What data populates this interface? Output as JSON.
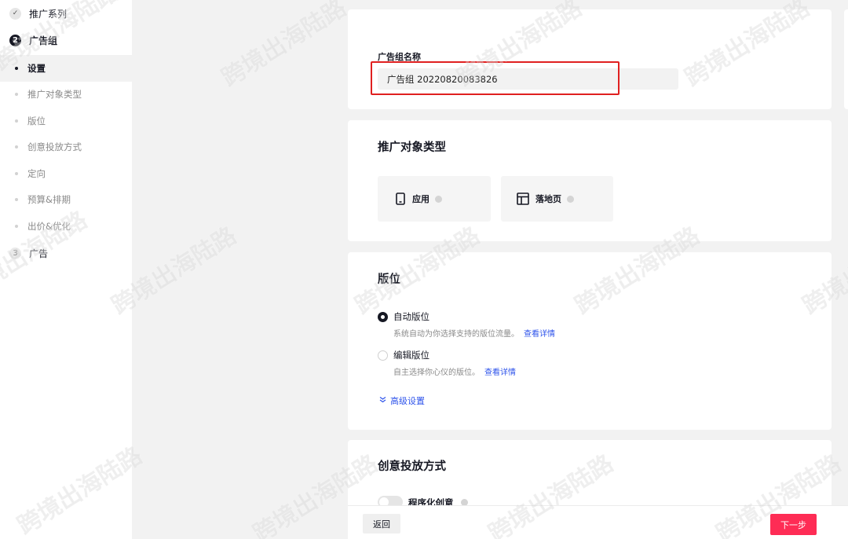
{
  "sidebar": {
    "steps": [
      {
        "index": "✓",
        "label": "推广系列"
      },
      {
        "index": "2",
        "label": "广告组"
      },
      {
        "index": "3",
        "label": "广告"
      }
    ],
    "subitems": [
      "设置",
      "推广对象类型",
      "版位",
      "创意投放方式",
      "定向",
      "预算&排期",
      "出价&优化"
    ]
  },
  "adgroup": {
    "name_label": "广告组名称",
    "name_value": "广告组 20220820083826"
  },
  "promo_type": {
    "title": "推广对象类型",
    "options": [
      "应用",
      "落地页"
    ]
  },
  "placement": {
    "title": "版位",
    "auto": {
      "label": "自动版位",
      "desc": "系统自动为你选择支持的版位流量。",
      "link": "查看详情"
    },
    "edit": {
      "label": "编辑版位",
      "desc": "自主选择你心仪的版位。",
      "link": "查看详情"
    },
    "advanced": "高级设置"
  },
  "creative": {
    "title": "创意投放方式",
    "toggle_label": "程序化创意"
  },
  "footer": {
    "back": "返回",
    "next": "下一步"
  },
  "watermark": "跨境出海陆路",
  "colors": {
    "accent": "#fe2c55",
    "link": "#2f54eb",
    "highlight": "#e02020"
  }
}
